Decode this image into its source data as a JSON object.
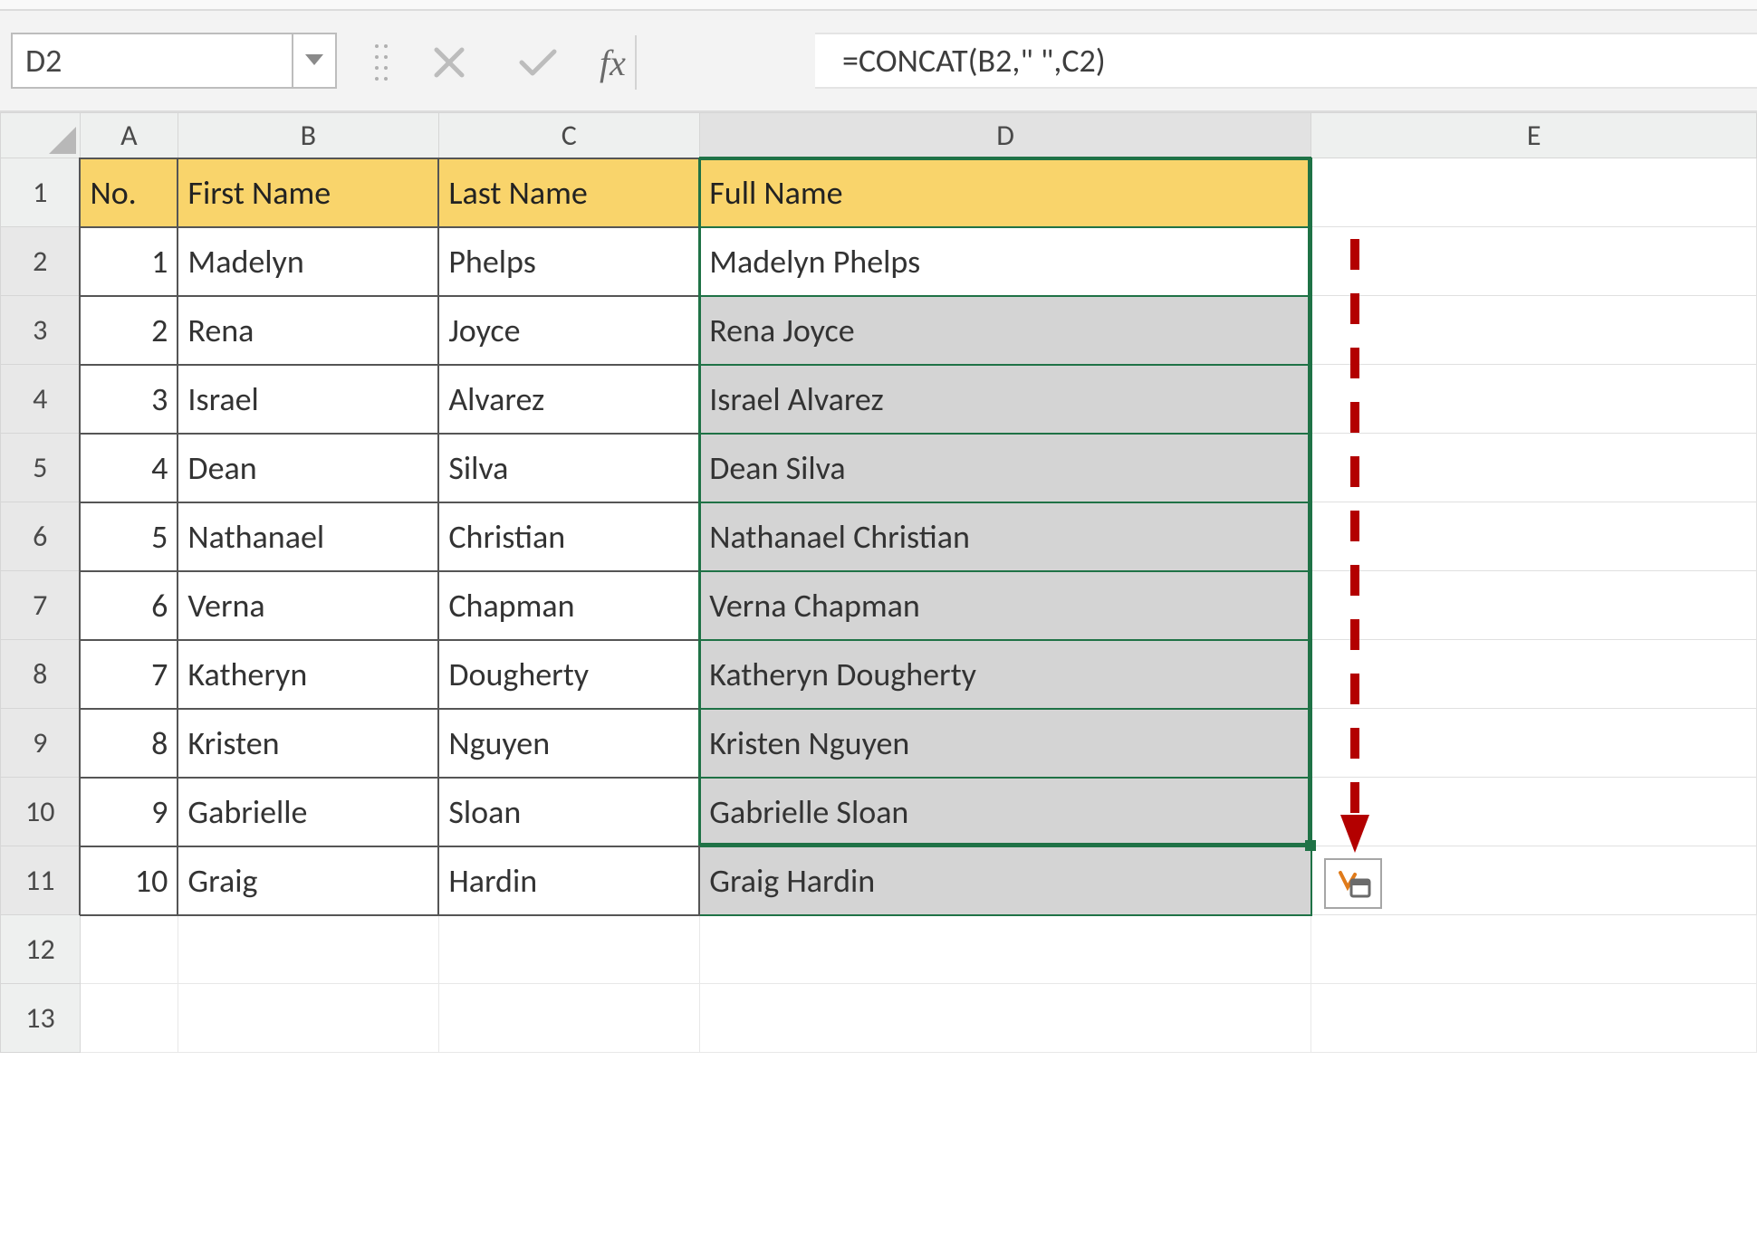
{
  "namebox": {
    "ref": "D2"
  },
  "formula_bar": {
    "fx_label": "fx",
    "content": "=CONCAT(B2,\" \",C2)"
  },
  "columns": [
    "A",
    "B",
    "C",
    "D",
    "E"
  ],
  "visible_rows": [
    "1",
    "2",
    "3",
    "4",
    "5",
    "6",
    "7",
    "8",
    "9",
    "10",
    "11",
    "12",
    "13"
  ],
  "headers": {
    "A": "No.",
    "B": "First Name",
    "C": "Last Name",
    "D": "Full Name"
  },
  "rows": [
    {
      "no": "1",
      "first": "Madelyn",
      "last": "Phelps",
      "full": "Madelyn Phelps"
    },
    {
      "no": "2",
      "first": "Rena",
      "last": "Joyce",
      "full": "Rena Joyce"
    },
    {
      "no": "3",
      "first": "Israel",
      "last": "Alvarez",
      "full": "Israel Alvarez"
    },
    {
      "no": "4",
      "first": "Dean",
      "last": "Silva",
      "full": "Dean Silva"
    },
    {
      "no": "5",
      "first": "Nathanael",
      "last": "Christian",
      "full": "Nathanael Christian"
    },
    {
      "no": "6",
      "first": "Verna",
      "last": "Chapman",
      "full": "Verna Chapman"
    },
    {
      "no": "7",
      "first": "Katheryn",
      "last": "Dougherty",
      "full": "Katheryn Dougherty"
    },
    {
      "no": "8",
      "first": "Kristen",
      "last": "Nguyen",
      "full": "Kristen Nguyen"
    },
    {
      "no": "9",
      "first": "Gabrielle",
      "last": "Sloan",
      "full": "Gabrielle Sloan"
    },
    {
      "no": "10",
      "first": "Graig",
      "last": "Hardin",
      "full": "Graig Hardin"
    }
  ],
  "selection": {
    "range": "D2:D11",
    "active": "D2"
  },
  "icons": {
    "dropdown": "chevron-down-icon",
    "cancel": "cancel-icon",
    "enter": "check-icon",
    "fx": "fx-icon",
    "autofill": "autofill-options-icon",
    "drag_handle": "drag-handle-icon"
  },
  "colors": {
    "header_fill": "#f9d46b",
    "selection_border": "#1f7246",
    "filled_bg": "#d4d4d4",
    "annotation": "#b30000"
  }
}
